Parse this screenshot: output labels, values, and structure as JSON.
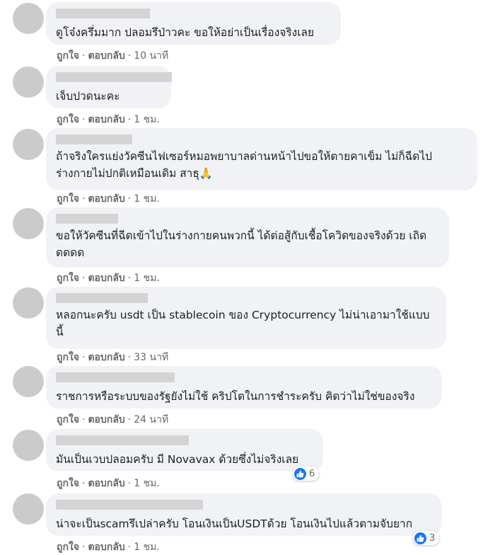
{
  "comments": [
    {
      "text": "ดูโจ๋งครึ่มมาก ปลอมรึป่าวคะ ขอให้อย่าเป็นเรื่องจริงเลย",
      "like": "ถูกใจ",
      "reply": "ตอบกลับ",
      "time": "10 นาที"
    },
    {
      "text": "เจ็บปวดนะคะ",
      "like": "ถูกใจ",
      "reply": "ตอบกลับ",
      "time": "1 ชม."
    },
    {
      "text": "ถ้าจริงใครแย่งวัคซีนไฟเซอร์หมอพยาบาลด่านหน้าไปขอให้ตายคาเข็ม ไม่ก็ฉีดไปร่างกายไม่ปกติเหมือนเดิม สาธุ🙏",
      "like": "ถูกใจ",
      "reply": "ตอบกลับ",
      "time": "1 ชม."
    },
    {
      "text": "ขอให้วัคซีนที่ฉีดเข้าไปในร่างกายคนพวกนี้ ได้ต่อสู้กับเชื้อโควิดของจริงด้วย เถิดดดดด",
      "like": "ถูกใจ",
      "reply": "ตอบกลับ",
      "time": "1 ชม."
    },
    {
      "text": "หลอกนะครับ usdt เป็น stablecoin ของ Cryptocurrency ไม่น่าเอามาใช้แบบนี้",
      "like": "ถูกใจ",
      "reply": "ตอบกลับ",
      "time": "33 นาที"
    },
    {
      "text": "ราชการหรือระบบของรัฐยังไม่ใช้ คริปโตในการชำระครับ คิดว่าไม่ใช่ของจริง",
      "like": "ถูกใจ",
      "reply": "ตอบกลับ",
      "time": "24 นาที"
    },
    {
      "text": "มันเป็นเวบปลอมครับ มี Novavax ด้วยซึ่งไม่จริงเลย",
      "like": "ถูกใจ",
      "reply": "ตอบกลับ",
      "time": "1 ชม.",
      "reactions": "6"
    },
    {
      "text": "น่าจะเป็นscamรึเปล่าครับ โอนเงินเป็นUSDTด้วย โอนเงินไปแล้วตามจับยาก",
      "like": "ถูกใจ",
      "reply": "ตอบกลับ",
      "time": "1 ชม.",
      "reactions": "3"
    }
  ],
  "colors": {
    "bubble": "#f0f2f5",
    "avatar": "#cbcbcb",
    "like_blue": "#1877f2",
    "meta": "#65676b"
  }
}
